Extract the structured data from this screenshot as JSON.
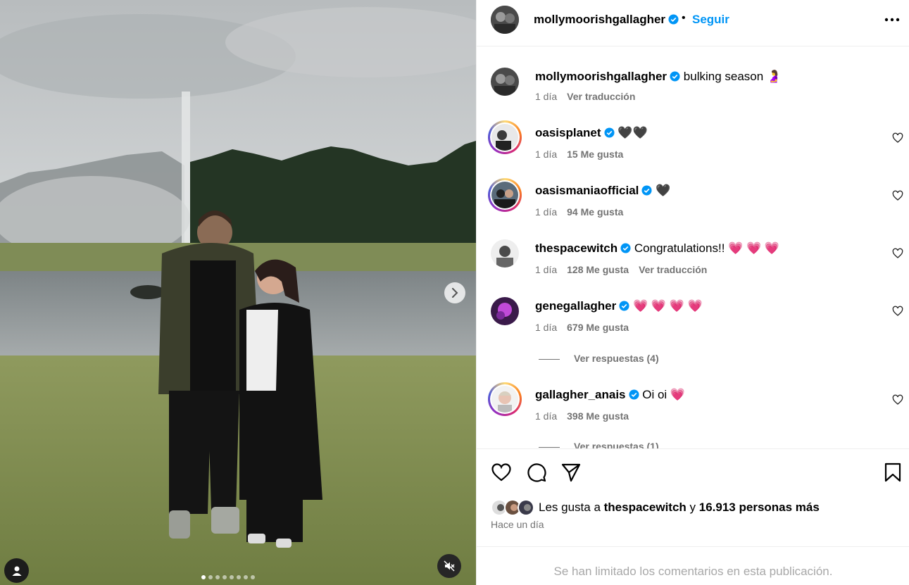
{
  "header": {
    "username": "mollymoorishgallagher",
    "separator": "•",
    "follow_label": "Seguir"
  },
  "caption": {
    "username": "mollymoorishgallagher",
    "text": "bulking season 🤰",
    "time": "1 día",
    "translate": "Ver traducción"
  },
  "comments": [
    {
      "username": "oasisplanet",
      "text": "🖤🖤",
      "time": "1 día",
      "likes": "15 Me gusta",
      "translate": ""
    },
    {
      "username": "oasismaniaofficial",
      "text": "🖤",
      "time": "1 día",
      "likes": "94 Me gusta",
      "translate": ""
    },
    {
      "username": "thespacewitch",
      "text": "Congratulations!! 💗 💗 💗",
      "time": "1 día",
      "likes": "128 Me gusta",
      "translate": "Ver traducción"
    },
    {
      "username": "genegallagher",
      "text": "💗 💗 💗 💗",
      "time": "1 día",
      "likes": "679 Me gusta",
      "translate": "",
      "replies": "Ver respuestas (4)"
    },
    {
      "username": "gallagher_anais",
      "text": "Oi oi 💗",
      "time": "1 día",
      "likes": "398 Me gusta",
      "translate": "",
      "replies": "Ver respuestas (1)"
    }
  ],
  "likes_line": {
    "prefix": "Les gusta a",
    "user": "thespacewitch",
    "conj": "y",
    "rest": "16.913 personas más"
  },
  "post_time": "Hace un día",
  "comments_limited": "Se han limitado los comentarios en esta publicación.",
  "carousel": {
    "count": 8,
    "active": 1
  },
  "colors": {
    "accent": "#0095f6",
    "verified": "#0095f6",
    "muted": "#737373"
  }
}
